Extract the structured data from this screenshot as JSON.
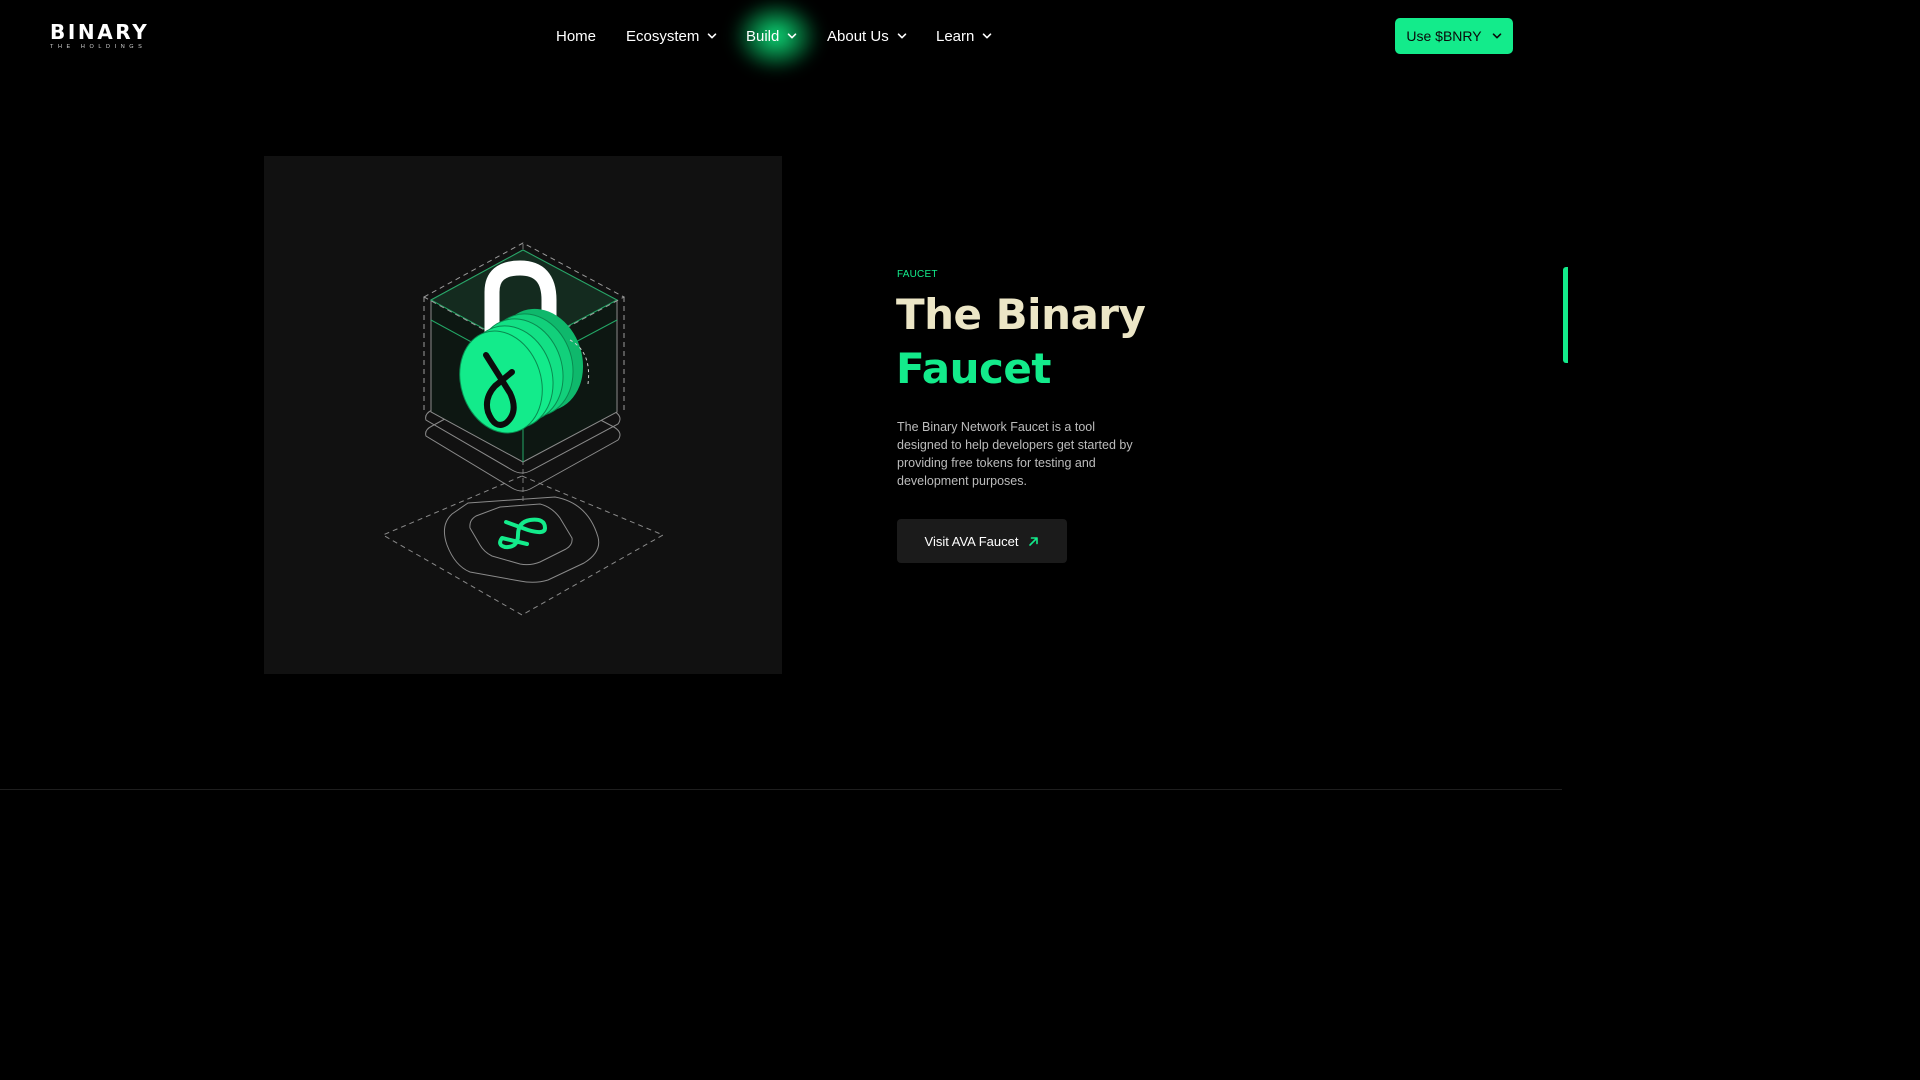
{
  "brand": {
    "name": "BINARY",
    "tagline": "THE HOLDINGS"
  },
  "nav": {
    "items": [
      {
        "label": "Home",
        "has_dropdown": false
      },
      {
        "label": "Ecosystem",
        "has_dropdown": true
      },
      {
        "label": "Build",
        "has_dropdown": true,
        "highlighted": true
      },
      {
        "label": "About Us",
        "has_dropdown": true
      },
      {
        "label": "Learn",
        "has_dropdown": true
      }
    ],
    "cta_label": "Use $BNRY"
  },
  "hero": {
    "eyebrow": "FAUCET",
    "title_line1": "The Binary",
    "title_line2": "Faucet",
    "description": "The Binary Network Faucet is a tool designed to help developers get started by providing free tokens for testing and development purposes.",
    "button_label": "Visit AVA Faucet",
    "illustration": "unlocked-padlock-on-cube-icon"
  },
  "colors": {
    "accent": "#13eb8b",
    "background": "#000000",
    "panel": "#111111",
    "title_primary": "#ece6c6",
    "body_text": "#bcbcbc"
  }
}
